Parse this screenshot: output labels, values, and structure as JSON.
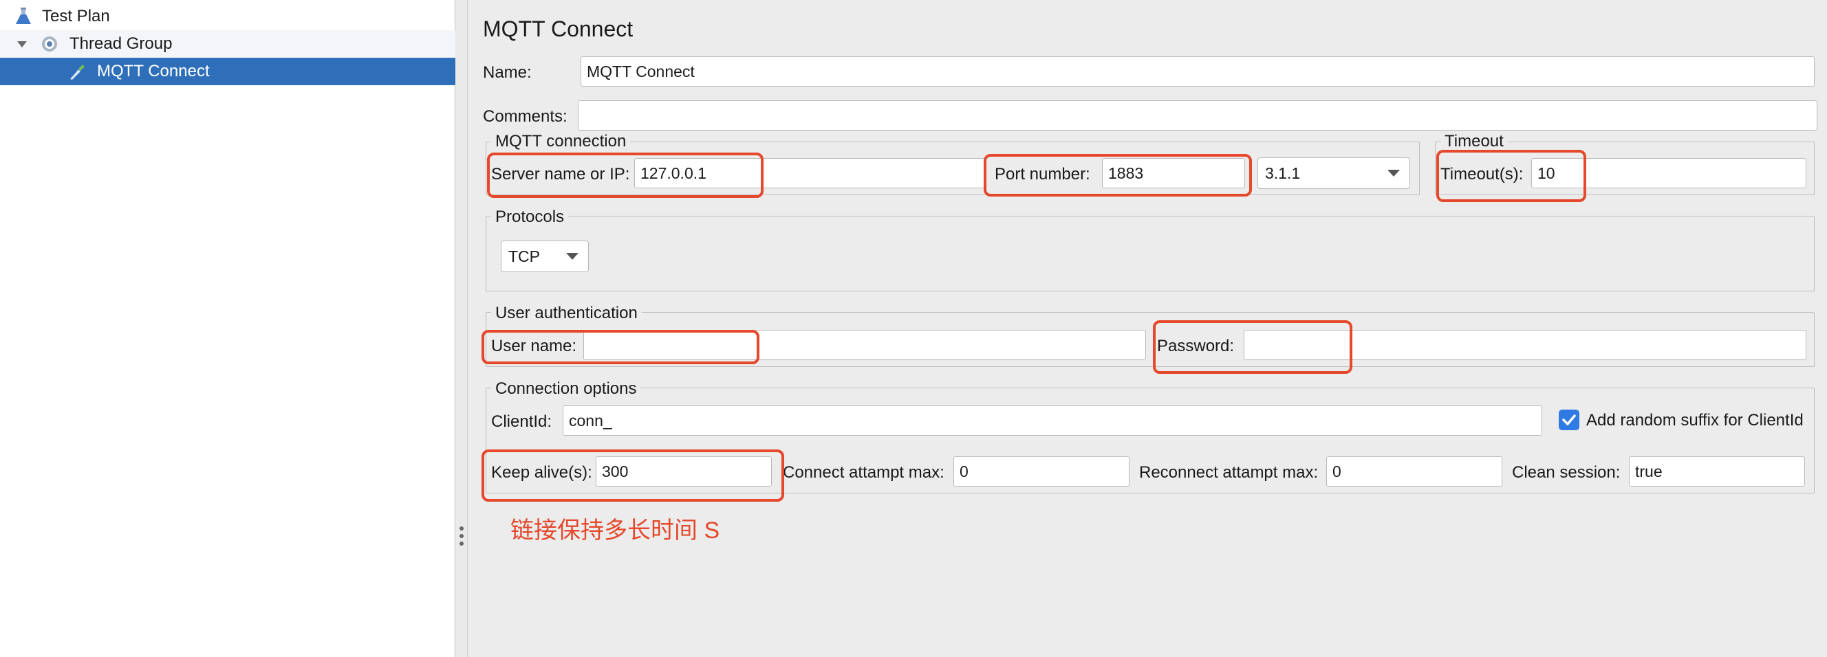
{
  "tree": {
    "items": [
      {
        "label": "Test Plan",
        "icon": "flask-icon"
      },
      {
        "label": "Thread Group",
        "icon": "gear-icon"
      },
      {
        "label": "MQTT Connect",
        "icon": "pipette-icon"
      }
    ]
  },
  "panel": {
    "title": "MQTT Connect",
    "name_label": "Name:",
    "name_value": "MQTT Connect",
    "comments_label": "Comments:",
    "comments_value": ""
  },
  "mqtt_connection": {
    "title": "MQTT connection",
    "server_label": "Server name or IP:",
    "server_value": "127.0.0.1",
    "port_label": "Port number:",
    "port_value": "1883",
    "version_value": "3.1.1"
  },
  "timeout": {
    "title": "Timeout",
    "label": "Timeout(s):",
    "value": "10"
  },
  "protocols": {
    "title": "Protocols",
    "value": "TCP"
  },
  "user_auth": {
    "title": "User authentication",
    "user_label": "User name:",
    "user_value": "",
    "password_label": "Password:",
    "password_value": ""
  },
  "connection_options": {
    "title": "Connection options",
    "clientid_label": "ClientId:",
    "clientid_value": "conn_",
    "random_suffix_label": "Add random suffix for ClientId",
    "random_suffix_checked": true,
    "keepalive_label": "Keep alive(s):",
    "keepalive_value": "300",
    "connect_max_label": "Connect attampt max:",
    "connect_max_value": "0",
    "reconnect_max_label": "Reconnect attampt max:",
    "reconnect_max_value": "0",
    "clean_session_label": "Clean session:",
    "clean_session_value": "true"
  },
  "annotation": {
    "keepalive_note": "链接保持多长时间 S"
  },
  "colors": {
    "selection": "#2f6fb9",
    "highlight": "#e5482b",
    "checkbox": "#2f7be3"
  }
}
